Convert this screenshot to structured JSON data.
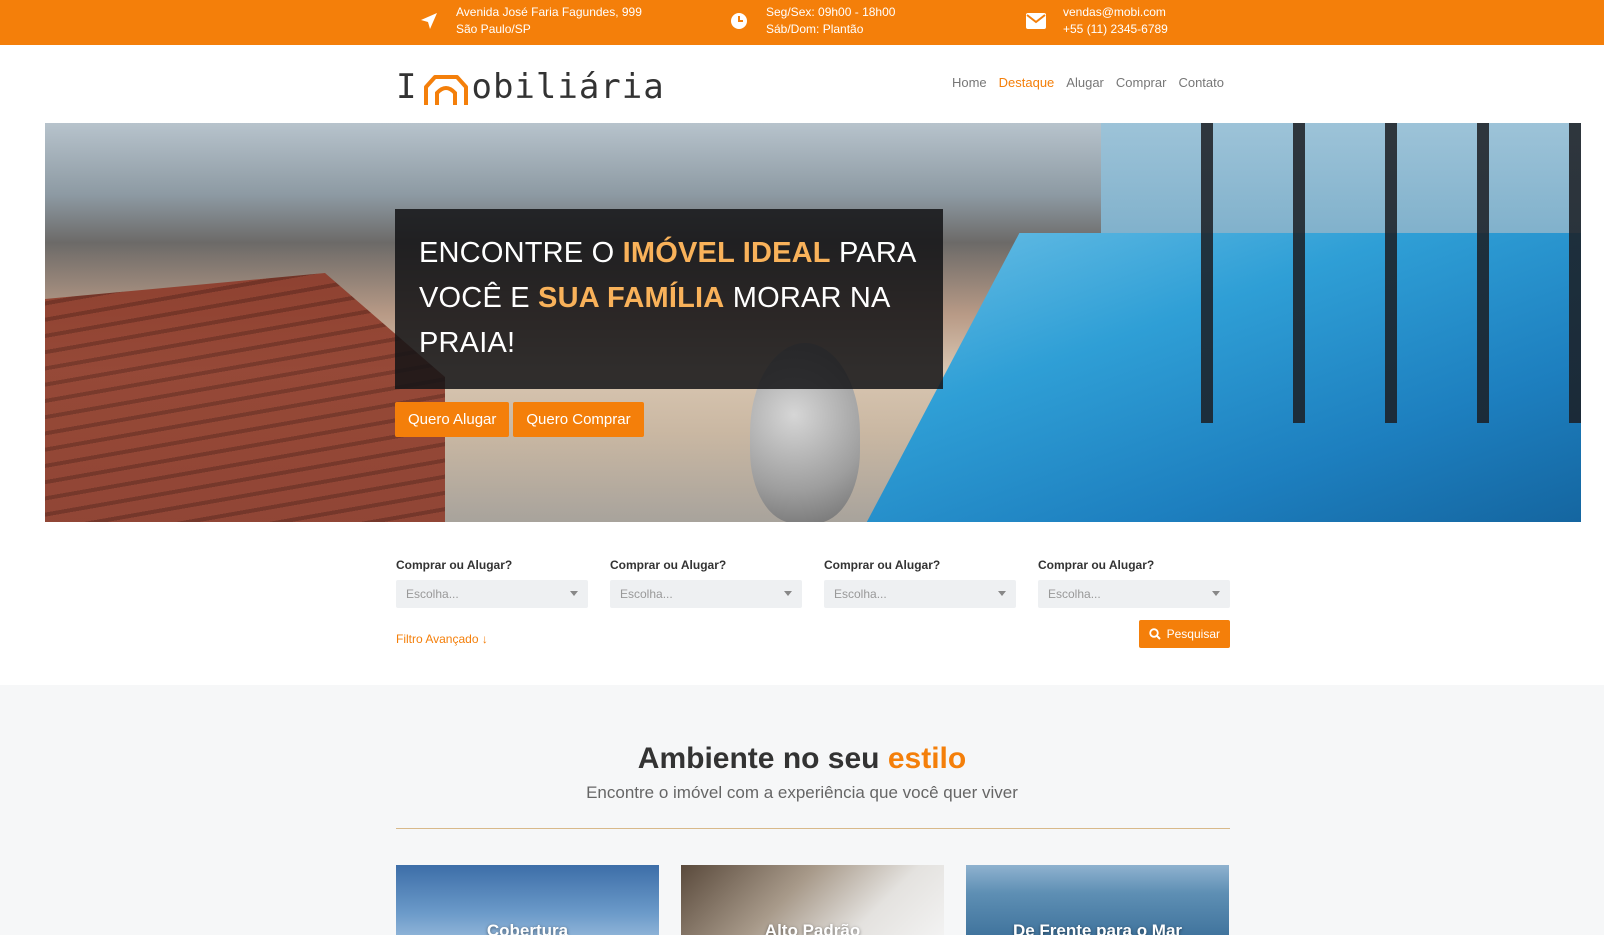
{
  "topbar": {
    "address": {
      "icon": "location-arrow-icon",
      "line1": "Avenida José Faria Fagundes, 999",
      "line2": "São Paulo/SP"
    },
    "hours": {
      "icon": "clock-icon",
      "line1": "Seg/Sex: 09h00 - 18h00",
      "line2": "Sáb/Dom: Plantão"
    },
    "contact": {
      "icon": "envelope-icon",
      "line1": "vendas@mobi.com",
      "line2": "+55 (11) 2345-6789"
    }
  },
  "header": {
    "logo_letter": "I",
    "logo_rest": "obiliária",
    "nav": [
      "Home",
      "Destaque",
      "Alugar",
      "Comprar",
      "Contato"
    ],
    "nav_active": "Destaque"
  },
  "hero": {
    "title_1": "ENCONTRE O ",
    "title_hl1": "IMÓVEL IDEAL",
    "title_2": " PARA VOCÊ E ",
    "title_hl2": "SUA FAMÍLIA",
    "title_3": " MORAR NA PRAIA!",
    "btn_rent": "Quero Alugar",
    "btn_buy": "Quero Comprar"
  },
  "search": {
    "fields": [
      {
        "label": "Comprar ou Alugar?",
        "placeholder": "Escolha..."
      },
      {
        "label": "Comprar ou Alugar?",
        "placeholder": "Escolha..."
      },
      {
        "label": "Comprar ou Alugar?",
        "placeholder": "Escolha..."
      },
      {
        "label": "Comprar ou Alugar?",
        "placeholder": "Escolha..."
      }
    ],
    "advanced_filter": "Filtro Avançado ↓",
    "search_button": "Pesquisar"
  },
  "section": {
    "title_main": "Ambiente no seu ",
    "title_accent": "estilo",
    "subtitle": "Encontre o imóvel com a experiência que você quer viver",
    "cards": [
      "Cobertura",
      "Alto Padrão",
      "De Frente para o Mar"
    ]
  },
  "colors": {
    "accent": "#f47f0a",
    "highlight": "#f9b25a",
    "dark_box": "#141416"
  }
}
